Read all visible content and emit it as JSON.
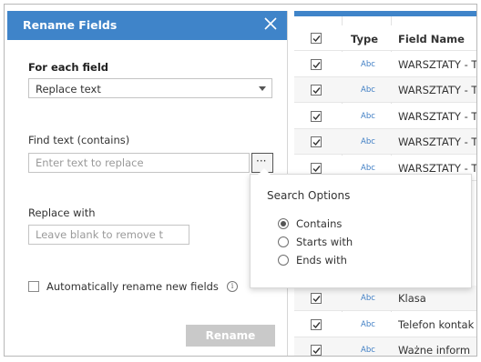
{
  "dialog": {
    "title": "Rename Fields",
    "for_each_label": "For each field",
    "for_each_value": "Replace text",
    "find_label": "Find text (contains)",
    "find_placeholder": "Enter text to replace",
    "more_label": "···",
    "replace_label": "Replace with",
    "replace_placeholder": "Leave blank to remove t",
    "auto_rename_label": "Automatically rename new fields",
    "info_glyph": "i",
    "rename_button": "Rename"
  },
  "search_options": {
    "title": "Search Options",
    "options": [
      {
        "label": "Contains",
        "selected": true
      },
      {
        "label": "Starts with",
        "selected": false
      },
      {
        "label": "Ends with",
        "selected": false
      }
    ]
  },
  "table": {
    "columns": {
      "type": "Type",
      "name": "Field Name"
    },
    "rows": [
      {
        "type": "Abc",
        "name": "WARSZTATY - T",
        "checked": true
      },
      {
        "type": "Abc",
        "name": "WARSZTATY - T",
        "checked": true
      },
      {
        "type": "Abc",
        "name": "WARSZTATY - T",
        "checked": true
      },
      {
        "type": "Abc",
        "name": "WARSZTATY - T",
        "checked": true
      },
      {
        "type": "Abc",
        "name": "WARSZTATY - T",
        "checked": true
      },
      {
        "type": "Abc",
        "name": "Klasa",
        "checked": true
      },
      {
        "type": "Abc",
        "name": "Telefon kontak",
        "checked": true
      },
      {
        "type": "Abc",
        "name": "Ważne inform",
        "checked": true
      }
    ]
  },
  "colors": {
    "header_blue": "#3f84c9",
    "disabled_button": "#c9c9c9"
  },
  "icons": {
    "close": "close-icon",
    "select_arrow": "chevron-down-icon",
    "info": "info-icon",
    "checkmark": "check-icon"
  }
}
